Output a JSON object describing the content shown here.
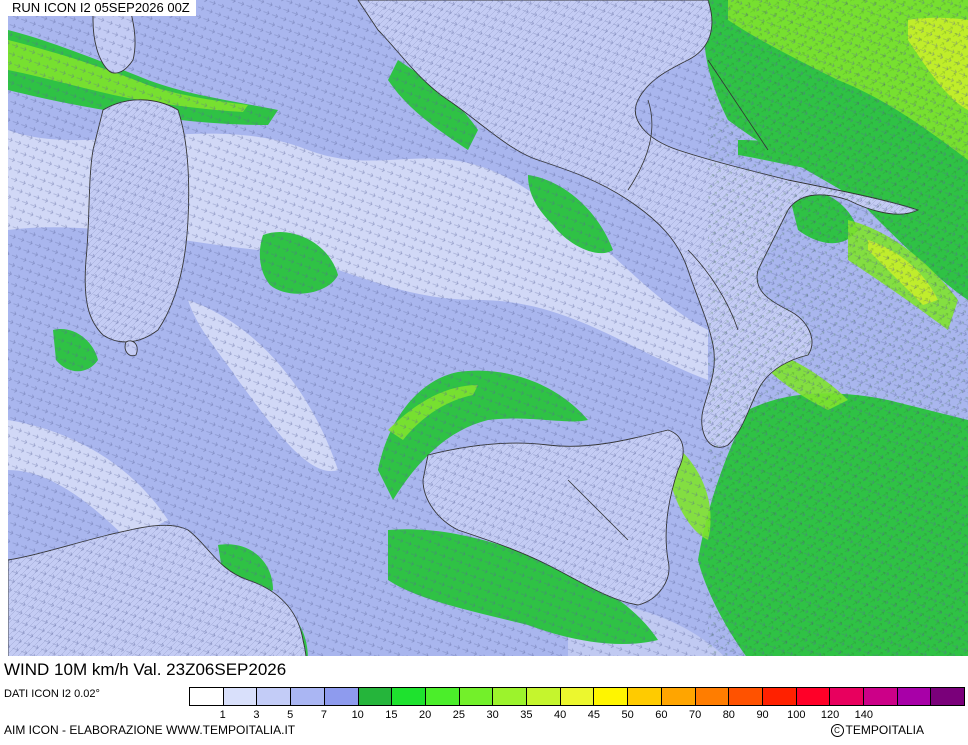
{
  "header": {
    "run_title": "RUN ICON I2 05SEP2026 00Z"
  },
  "footer": {
    "wind_title": "WIND 10M km/h Val. 23Z06SEP2026",
    "data_source": "DATI ICON I2 0.02°",
    "credit": "AIM ICON - ELABORAZIONE WWW.TEMPOITALIA.IT",
    "copyright_symbol": "C",
    "copyright": "TEMPOITALIA"
  },
  "legend": {
    "colors": [
      "#ffffff",
      "#d9e0fb",
      "#c3ccf7",
      "#aab6f3",
      "#8e9bee",
      "#25b53b",
      "#1ee22e",
      "#4bee2a",
      "#73f02a",
      "#9cf32c",
      "#c5f52d",
      "#ecf72e",
      "#fff500",
      "#ffcb00",
      "#ffa500",
      "#ff7d00",
      "#ff5200",
      "#ff2100",
      "#ff0028",
      "#e8005e",
      "#cc0088",
      "#a800a8",
      "#7a007a"
    ],
    "labels": [
      "1",
      "3",
      "5",
      "7",
      "10",
      "15",
      "20",
      "25",
      "30",
      "35",
      "40",
      "45",
      "50",
      "60",
      "70",
      "80",
      "90",
      "100",
      "120",
      "140"
    ]
  },
  "map_colors": {
    "calm_light": "#d2d8f6",
    "calm_mid": "#a9b6ee",
    "land": "#c4ccf4",
    "wind_green": "#2fc245",
    "wind_lime": "#7fe32e",
    "wind_yellow": "#c8ee2a",
    "coast": "#333333"
  }
}
